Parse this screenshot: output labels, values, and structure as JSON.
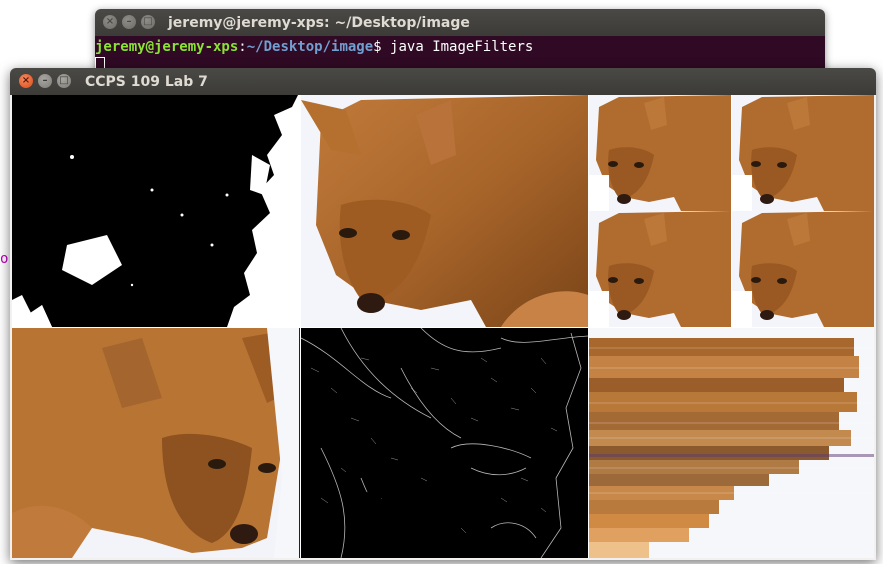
{
  "terminal": {
    "title": "jeremy@jeremy-xps: ~/Desktop/image",
    "prompt_user": "jeremy@jeremy-xps",
    "prompt_sep": ":",
    "prompt_path": "~/Desktop/image",
    "prompt_symbol": "$",
    "command": "java ImageFilters"
  },
  "window": {
    "title": "CCPS 109 Lab 7",
    "close_glyph": "×",
    "minimize_glyph": "–",
    "maximize_glyph": "□"
  },
  "side_fragment": "o",
  "images": [
    {
      "name": "threshold-image",
      "description_filter": "black and white threshold"
    },
    {
      "name": "original-coyote-image",
      "description_filter": "original"
    },
    {
      "name": "tiled-coyote-image",
      "description_filter": "2x2 tiling"
    },
    {
      "name": "zoomed-coyote-image",
      "description_filter": "zoom"
    },
    {
      "name": "edge-detect-image",
      "description_filter": "edge detection"
    },
    {
      "name": "smear-image",
      "description_filter": "horizontal smear"
    }
  ],
  "colors": {
    "terminal_bg": "#300a24",
    "titlebar": "#3c3b37",
    "coyote_fur": "#b56a2a",
    "snow": "#f4f6fb"
  }
}
